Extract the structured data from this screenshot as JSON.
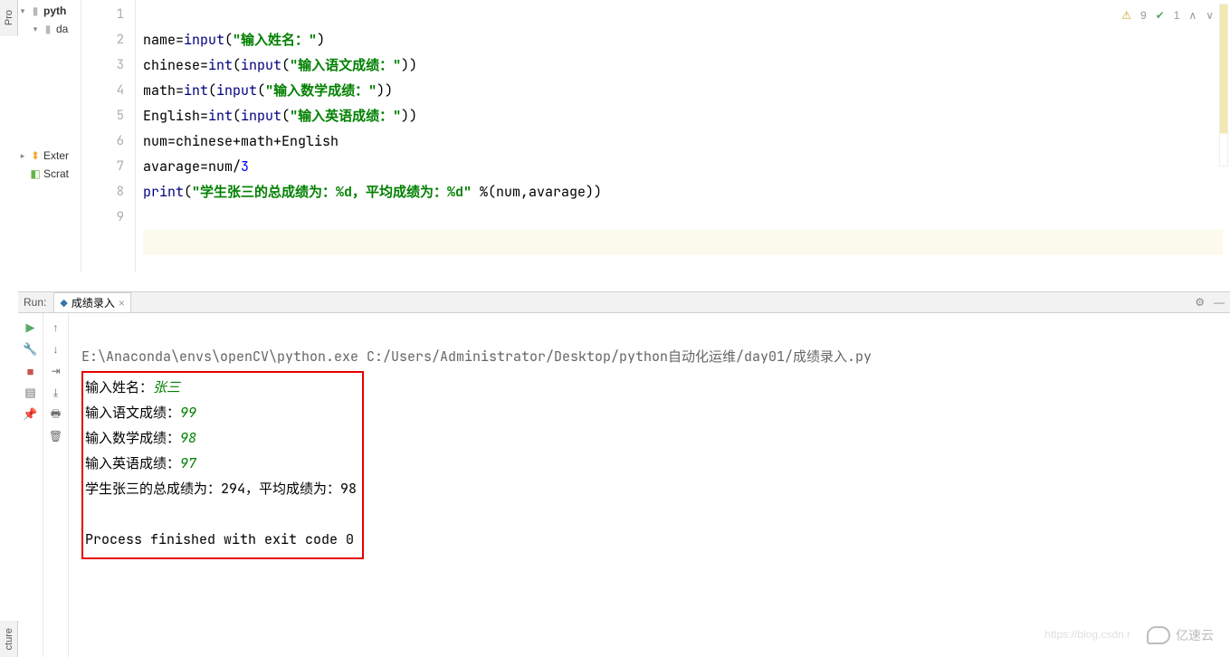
{
  "sidebar": {
    "project_label": "Pro",
    "structure_label": "cture",
    "tree": {
      "root": "pyth",
      "folder1": "da",
      "external": "Exter",
      "scratches": "Scrat"
    }
  },
  "editor": {
    "line_numbers": [
      "1",
      "2",
      "3",
      "4",
      "5",
      "6",
      "7",
      "8",
      "9"
    ],
    "code": {
      "l1": {
        "a": "name=",
        "fn": "input",
        "p1": "(",
        "s": "\"输入姓名：\"",
        "p2": ")"
      },
      "l2": {
        "a": "chinese=",
        "fn1": "int",
        "p1": "(",
        "fn2": "input",
        "p2": "(",
        "s": "\"输入语文成绩：\"",
        "p3": "))"
      },
      "l3": {
        "a": "math=",
        "fn1": "int",
        "p1": "(",
        "fn2": "input",
        "p2": "(",
        "s": "\"输入数学成绩：\"",
        "p3": "))"
      },
      "l4": {
        "a": "English=",
        "fn1": "int",
        "p1": "(",
        "fn2": "input",
        "p2": "(",
        "s": "\"输入英语成绩：\"",
        "p3": "))"
      },
      "l5": "num=chinese+math+English",
      "l6": {
        "a": "avarage=num/",
        "n": "3"
      },
      "l7": {
        "fn": "print",
        "p1": "(",
        "s": "\"学生张三的总成绩为：%d，平均成绩为：%d\"",
        "rest": " %(num,avarage))"
      }
    },
    "inspections": {
      "warn_count": "9",
      "ok_count": "1"
    }
  },
  "run": {
    "label": "Run:",
    "tab_name": "成绩录入",
    "command": "E:\\Anaconda\\envs\\openCV\\python.exe C:/Users/Administrator/Desktop/python自动化运维/day01/成绩录入.py",
    "output": {
      "p1": "输入姓名：",
      "v1": "张三",
      "p2": "输入语文成绩：",
      "v2": "99",
      "p3": "输入数学成绩：",
      "v3": "98",
      "p4": "输入英语成绩：",
      "v4": "97",
      "result": "学生张三的总成绩为：294，平均成绩为：98",
      "exit": "Process finished with exit code 0"
    }
  },
  "watermark": {
    "text": "亿速云",
    "url": "https://blog.csdn.r"
  }
}
